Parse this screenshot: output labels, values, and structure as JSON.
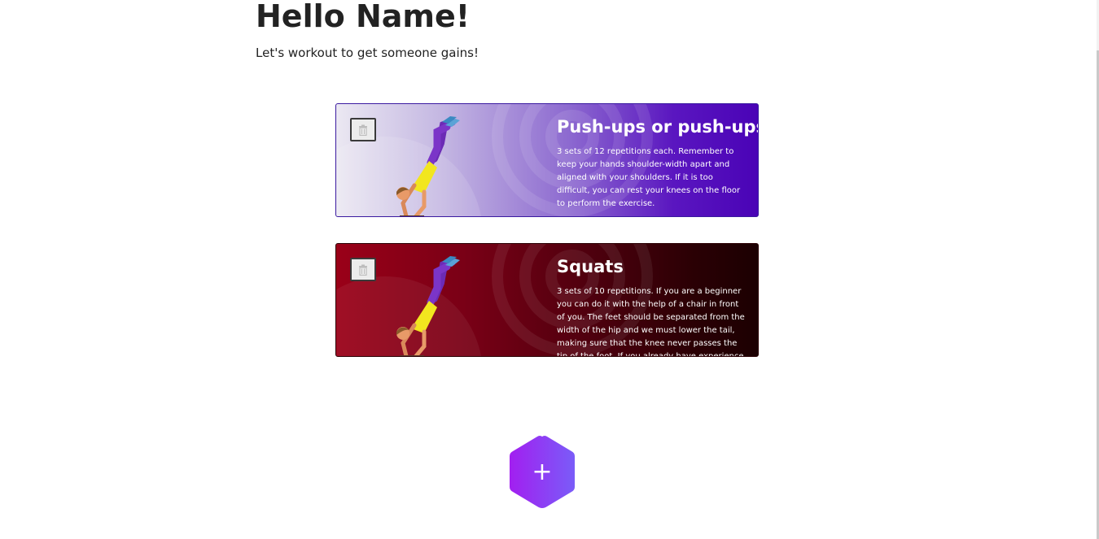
{
  "header": {
    "greeting": "Hello Name!",
    "subtitle": "Let's workout to get someone gains!"
  },
  "workouts": [
    {
      "title": "Push-ups or push-ups",
      "description": "3 sets of 12 repetitions each. Remember to keep your hands shoulder-width apart and aligned with your shoulders. If it is too difficult, you can rest your knees on the floor to perform the exercise.",
      "delete_icon": "trash-icon",
      "illustration": "handstand-athlete",
      "theme": {
        "from": "#ebe8f2",
        "to": "#4a03b6"
      }
    },
    {
      "title": "Squats",
      "description": "3 sets of 10 repetitions. If you are a beginner you can do it with the help of a chair in front of you. The feet should be separated from the width of the hip and we must lower the tail, making sure that the knee never passes the tip of the foot. If you already have experience",
      "delete_icon": "trash-icon",
      "illustration": "handstand-athlete",
      "theme": {
        "from": "#9a0018",
        "to": "#1c0002"
      }
    }
  ],
  "add_button": {
    "label": "+",
    "icon": "plus-icon",
    "gradient": {
      "from": "#a21ff0",
      "to": "#7a5cf8"
    }
  }
}
